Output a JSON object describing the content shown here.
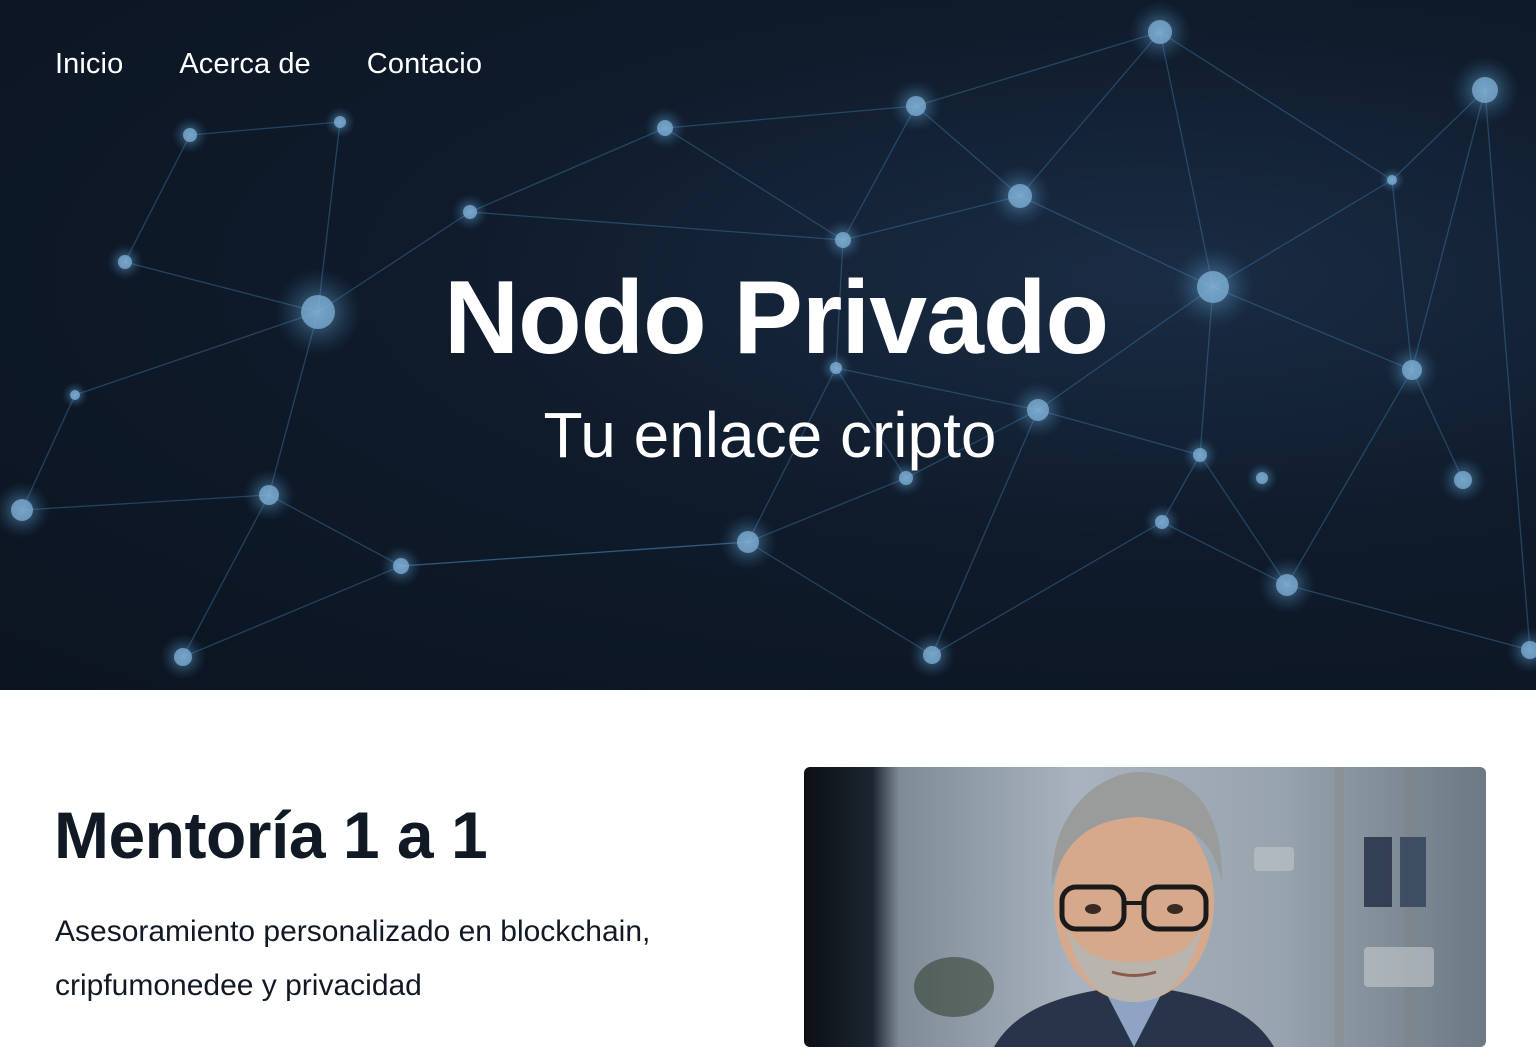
{
  "nav": {
    "items": [
      {
        "label": "Inicio"
      },
      {
        "label": "Acerca de"
      },
      {
        "label": "Contacio"
      }
    ]
  },
  "hero": {
    "title": "Nodo Privado",
    "subtitle": "Tu enlace cripto",
    "background": "blockchain-network-graphic"
  },
  "mentoring": {
    "title": "Mentoría 1 a 1",
    "description": "Asesoramiento personalizado en blockchain, cripfumonedee y privacidad",
    "photo": "mentor-portrait"
  },
  "colors": {
    "hero_bg": "#0f1b2b",
    "node_glow": "#6fa8d6",
    "text_dark": "#111a24",
    "text_light": "#ffffff"
  }
}
